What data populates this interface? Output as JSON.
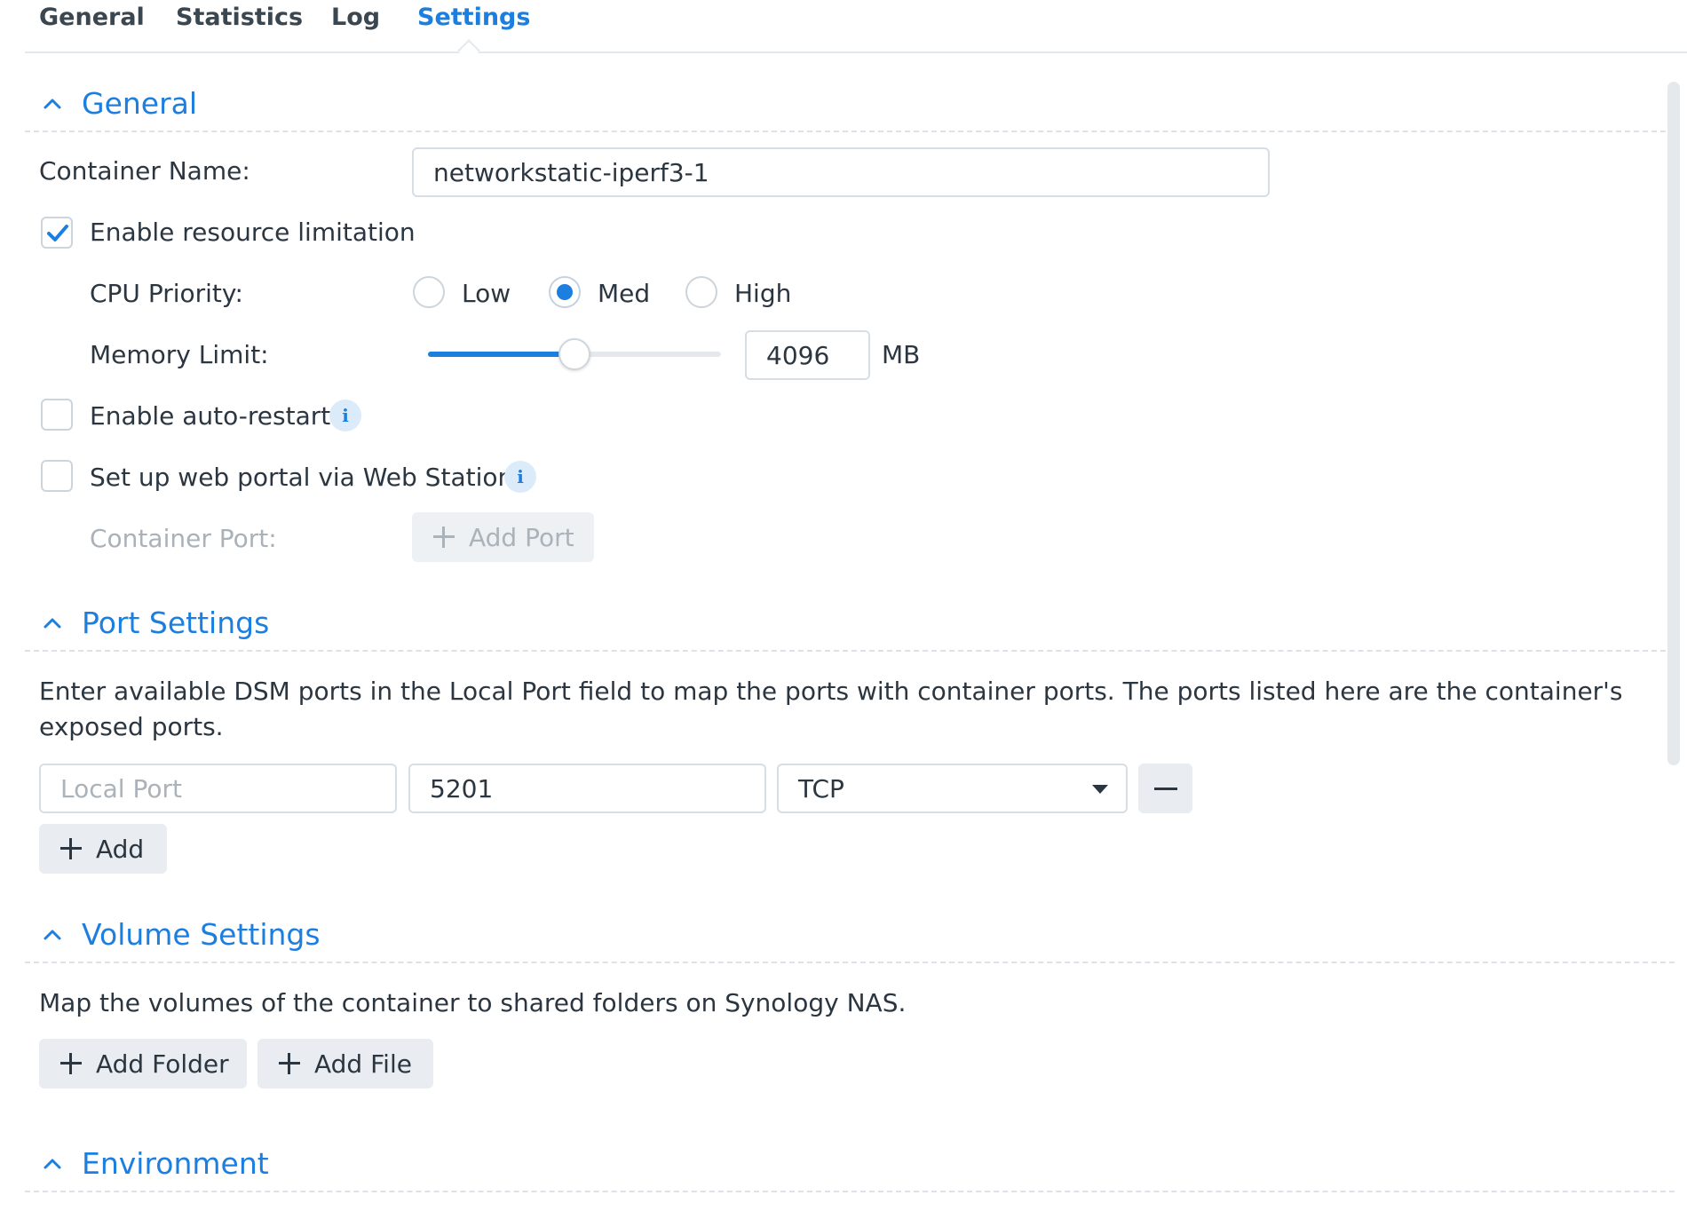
{
  "tabs": [
    "General",
    "Statistics",
    "Log",
    "Settings"
  ],
  "active_tab": "Settings",
  "sections": {
    "general": {
      "title": "General",
      "container_name_label": "Container Name:",
      "container_name_value": "networkstatic-iperf3-1",
      "enable_resource_limitation": {
        "label": "Enable resource limitation",
        "checked": true
      },
      "cpu_priority": {
        "label": "CPU Priority:",
        "options": [
          "Low",
          "Med",
          "High"
        ],
        "selected": "Med"
      },
      "memory_limit": {
        "label": "Memory Limit:",
        "value": "4096",
        "unit": "MB",
        "slider_fraction": 0.5
      },
      "enable_auto_restart": {
        "label": "Enable auto-restart",
        "checked": false
      },
      "web_portal": {
        "label": "Set up web portal via Web Station",
        "checked": false
      },
      "container_port": {
        "label": "Container Port:",
        "add_port_label": "Add Port"
      }
    },
    "port_settings": {
      "title": "Port Settings",
      "description": "Enter available DSM ports in the Local Port field to map the ports with container ports. The ports listed here are the container's exposed ports.",
      "rows": [
        {
          "local_port_placeholder": "Local Port",
          "local_port_value": "",
          "container_port": "5201",
          "protocol": "TCP"
        }
      ],
      "add_label": "Add"
    },
    "volume_settings": {
      "title": "Volume Settings",
      "description": "Map the volumes of the container to shared folders on Synology NAS.",
      "add_folder_label": "Add Folder",
      "add_file_label": "Add File"
    },
    "environment": {
      "title": "Environment"
    }
  },
  "colors": {
    "accent": "#1c7fe0",
    "text": "#2b3640",
    "muted_text": "#a9b1b9",
    "button_bg": "#e9edf1"
  }
}
